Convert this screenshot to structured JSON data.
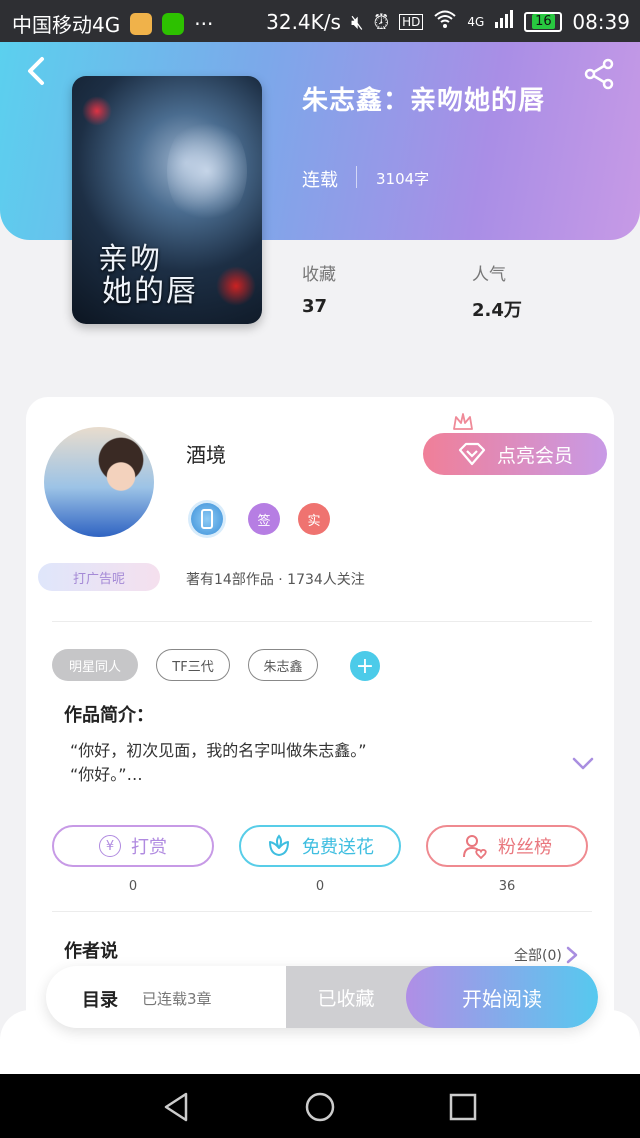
{
  "status_bar": {
    "carrier": "中国移动4G",
    "net_speed": "32.4K/s",
    "hd": "HD",
    "network": "4G",
    "battery": "16",
    "time": "08:39"
  },
  "book": {
    "title": "朱志鑫：亲吻她的唇",
    "cover_title_line1": "亲吻",
    "cover_title_line2": "她的唇",
    "status": "连载",
    "word_count": "3104字",
    "collect_label": "收藏",
    "collect_value": "37",
    "popularity_label": "人气",
    "popularity_value": "2.4万"
  },
  "author": {
    "name": "酒境",
    "vip_button": "点亮会员",
    "badge_sign": "签",
    "badge_real": "实",
    "ad_tag": "打广告呢",
    "meta": "著有14部作品 · 1734人关注"
  },
  "tags": [
    "明星同人",
    "TF三代",
    "朱志鑫"
  ],
  "tag_add": "+",
  "intro": {
    "title": "作品简介：",
    "line1": "“你好，初次见面，我的名字叫做朱志鑫。”",
    "line2": "“你好。”…"
  },
  "actions": {
    "tip_label": "打赏",
    "tip_symbol": "¥",
    "tip_count": "0",
    "flower_label": "免费送花",
    "flower_count": "0",
    "fans_label": "粉丝榜",
    "fans_count": "36"
  },
  "author_says": {
    "title": "作者说",
    "all_link": "全部(0)"
  },
  "bottom": {
    "toc_label": "目录",
    "toc_count": "已连载3章",
    "collected": "已收藏",
    "read": "开始阅读"
  },
  "colors": {
    "header_start": "#5bd0ee",
    "header_end": "#c79ae6",
    "vip_pink": "#f07f98",
    "tip_purple": "#c79ae6",
    "flower_cyan": "#58cde8",
    "fans_red": "#ef8a90"
  }
}
